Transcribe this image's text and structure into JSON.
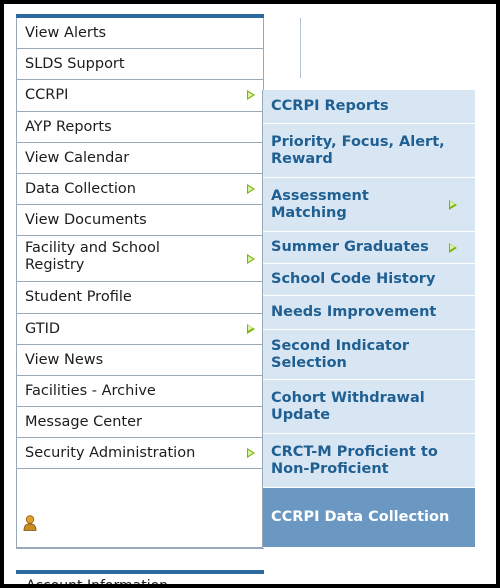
{
  "left_menu": {
    "items": [
      {
        "label": "View Alerts",
        "submenu": false
      },
      {
        "label": "SLDS Support",
        "submenu": false
      },
      {
        "label": "CCRPI",
        "submenu": true
      },
      {
        "label": "AYP Reports",
        "submenu": false
      },
      {
        "label": "View Calendar",
        "submenu": false
      },
      {
        "label": "Data Collection",
        "submenu": true
      },
      {
        "label": "View Documents",
        "submenu": false
      },
      {
        "label": "Facility and School Registry",
        "submenu": true
      },
      {
        "label": "Student Profile",
        "submenu": false
      },
      {
        "label": "GTID",
        "submenu": true
      },
      {
        "label": "View News",
        "submenu": false
      },
      {
        "label": "Facilities - Archive",
        "submenu": false
      },
      {
        "label": "Message Center",
        "submenu": false
      },
      {
        "label": "Security Administration",
        "submenu": true
      }
    ],
    "account_label": "Account Information"
  },
  "ccrpi_submenu": {
    "items": [
      {
        "label": "CCRPI Reports",
        "submenu": false
      },
      {
        "label": "Priority, Focus, Alert, Reward",
        "submenu": false
      },
      {
        "label": "Assessment Matching",
        "submenu": true
      },
      {
        "label": "Summer Graduates",
        "submenu": true
      },
      {
        "label": "School Code History",
        "submenu": false
      },
      {
        "label": "Needs Improvement",
        "submenu": false
      },
      {
        "label": "Second Indicator Selection",
        "submenu": false
      },
      {
        "label": "Cohort Withdrawal Update",
        "submenu": false
      },
      {
        "label": "CRCT-M Proficient to Non-Proficient",
        "submenu": false
      },
      {
        "label": "CCRPI Data Collection",
        "submenu": false,
        "active": true
      }
    ]
  },
  "colors": {
    "menu_bar_blue": "#2c6aa0",
    "submenu_bg": "#d8e6f3",
    "submenu_text": "#1f5f92",
    "submenu_active": "#6a98c2",
    "arrow_green": "#7ab800"
  },
  "icons": {
    "submenu_arrow": "green-triangle-arrow-icon",
    "user": "user-icon"
  }
}
